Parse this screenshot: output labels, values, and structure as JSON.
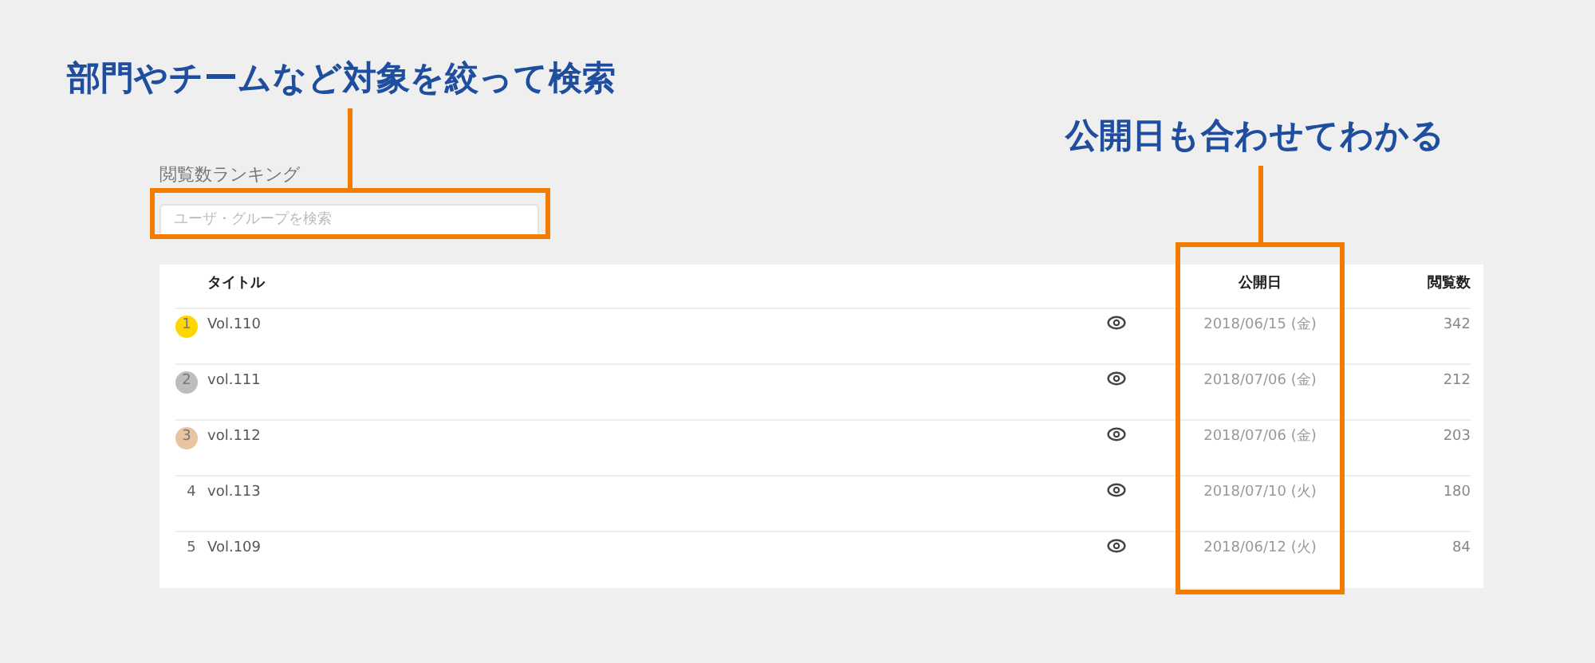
{
  "annotations": [
    {
      "text": "部門やチームなど対象を絞って検索"
    },
    {
      "text": "公開日も合わせてわかる"
    }
  ],
  "ranking": {
    "title": "閲覧数ランキング",
    "search": {
      "placeholder": "ユーザ・グループを検索"
    },
    "columns": [
      "タイトル",
      "公開日",
      "閲覧数"
    ],
    "rows": [
      {
        "rank": "1",
        "color": "#ffd700",
        "title": "Vol.110",
        "date": "2018/06/15 (金)",
        "views": "342"
      },
      {
        "rank": "2",
        "color": "#bdbdbd",
        "title": "vol.111",
        "date": "2018/07/06 (金)",
        "views": "212"
      },
      {
        "rank": "3",
        "color": "#e8c4a0",
        "title": "vol.112",
        "date": "2018/07/06 (金)",
        "views": "203"
      },
      {
        "rank": "4",
        "title": "vol.113",
        "date": "2018/07/10 (火)",
        "views": "180"
      },
      {
        "rank": "5",
        "title": "Vol.109",
        "date": "2018/06/12 (火)",
        "views": "84"
      }
    ]
  }
}
